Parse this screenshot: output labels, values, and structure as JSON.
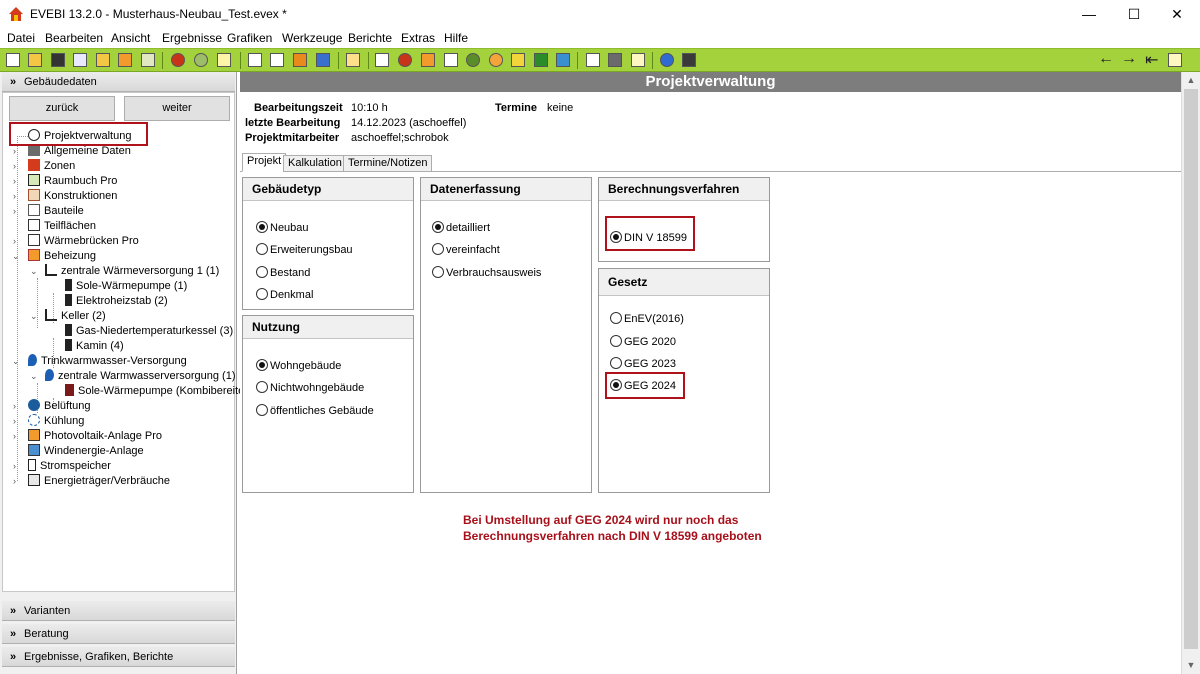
{
  "window": {
    "title": "EVEBI 13.2.0 - Musterhaus-Neubau_Test.evex *",
    "minimize": "—",
    "maximize": "☐",
    "close": "✕"
  },
  "menu": [
    "Datei",
    "Bearbeiten",
    "Ansicht",
    "Ergebnisse",
    "Grafiken",
    "Werkzeuge",
    "Berichte",
    "Extras",
    "Hilfe"
  ],
  "toolbar": {
    "back_arrow": "←",
    "forward_arrow": "→",
    "pin_arrow": "⇤"
  },
  "leftpanel": {
    "section_top": "Gebäudedaten",
    "buttons": {
      "back": "zurück",
      "forward": "weiter"
    },
    "tree": [
      "Projektverwaltung",
      "Allgemeine Daten",
      "Zonen",
      "Raumbuch Pro",
      "Konstruktionen",
      "Bauteile",
      "Teilflächen",
      "Wärmebrücken Pro",
      "Beheizung",
      "zentrale Wärmeversorgung 1 (1)",
      "Sole-Wärmepumpe (1)",
      "Elektroheizstab (2)",
      "Keller (2)",
      "Gas-Niedertemperaturkessel (3)",
      "Kamin (4)",
      "Trinkwarmwasser-Versorgung",
      "zentrale Warmwasserversorgung (1)",
      "Sole-Wärmepumpe (Kombibereiter",
      "Belüftung",
      "Kühlung",
      "Photovoltaik-Anlage Pro",
      "Windenergie-Anlage",
      "Stromspeicher",
      "Energieträger/Verbräuche"
    ],
    "sections_bottom": [
      "Varianten",
      "Beratung",
      "Ergebnisse, Grafiken, Berichte"
    ]
  },
  "main": {
    "header": "Projektverwaltung",
    "info": {
      "bearbeitungszeit_label": "Bearbeitungszeit",
      "bearbeitungszeit_value": "10:10 h",
      "letzte_label": "letzte Bearbeitung",
      "letzte_value": "14.12.2023 (aschoeffel)",
      "mitarbeiter_label": "Projektmitarbeiter",
      "mitarbeiter_value": "aschoeffel;schrobok",
      "termine_label": "Termine",
      "termine_value": "keine"
    },
    "tabs": [
      "Projekt",
      "Kalkulation",
      "Termine/Notizen"
    ],
    "groups": {
      "gebaeudetyp": {
        "title": "Gebäudetyp",
        "options": [
          "Neubau",
          "Erweiterungsbau",
          "Bestand",
          "Denkmal"
        ],
        "selected": 0
      },
      "nutzung": {
        "title": "Nutzung",
        "options": [
          "Wohngebäude",
          "Nichtwohngebäude",
          "öffentliches Gebäude"
        ],
        "selected": 0
      },
      "datenerfassung": {
        "title": "Datenerfassung",
        "options": [
          "detailliert",
          "vereinfacht",
          "Verbrauchsausweis"
        ],
        "selected": 0
      },
      "berechnungsverfahren": {
        "title": "Berechnungsverfahren",
        "options": [
          "DIN V 18599"
        ],
        "selected": 0
      },
      "gesetz": {
        "title": "Gesetz",
        "options": [
          "EnEV(2016)",
          "GEG 2020",
          "GEG 2023",
          "GEG 2024"
        ],
        "selected": 3
      }
    },
    "note_line1": "Bei Umstellung auf GEG 2024 wird nur noch das",
    "note_line2": "Berechnungsverfahren nach DIN V 18599 angeboten"
  },
  "colors": {
    "toolbar": "#a4d23c",
    "header_band": "#7d7d7d",
    "highlight_box": "#b0121c",
    "note_text": "#a7101a"
  }
}
